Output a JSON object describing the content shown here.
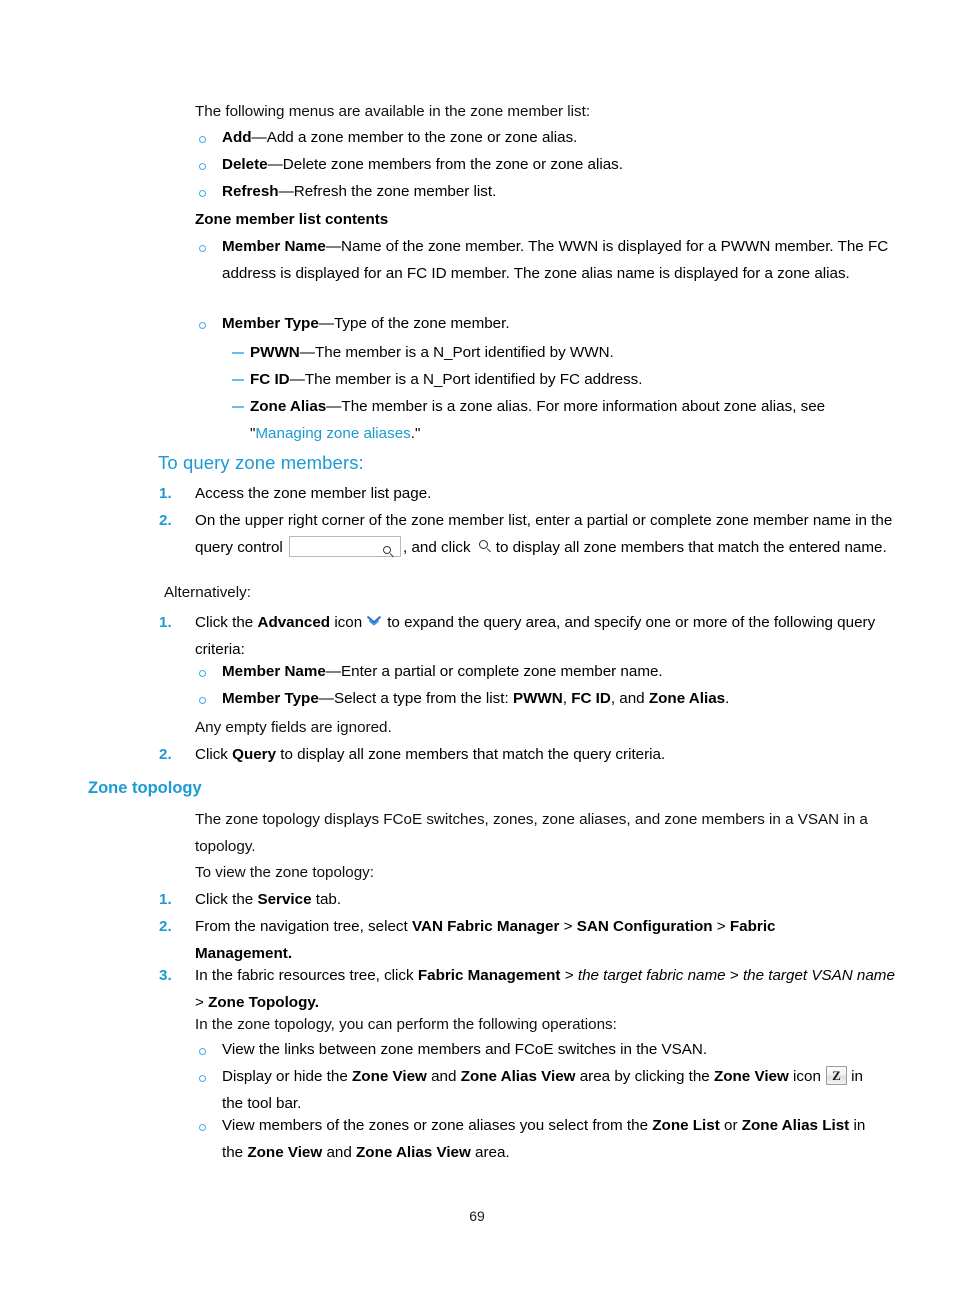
{
  "page": {
    "folio": "69"
  },
  "intro": {
    "text": "The following menus are available in the zone member list:"
  },
  "menu_bullets": [
    {
      "term": "Add",
      "dash": "—",
      "desc": "Add a zone member to the zone or zone alias."
    },
    {
      "term": "Delete",
      "dash": "—",
      "desc": "Delete zone members from the zone or zone alias."
    },
    {
      "term": "Refresh",
      "dash": "—",
      "desc": "Refresh the zone member list."
    }
  ],
  "contents_heading": "Zone member list contents",
  "contents_bullets": [
    {
      "term": "Member Name",
      "dash": "—",
      "desc": "Name of the zone member. The WWN is displayed for a PWWN member. The FC address is displayed for an FC ID member. The zone alias name is displayed for a zone alias."
    },
    {
      "term": "Member Type",
      "dash": "—",
      "desc": "Type of the zone member."
    }
  ],
  "member_types": [
    {
      "term": "PWWN",
      "dash": "—",
      "desc": "The member is a N_Port identified by WWN."
    },
    {
      "term": "FC ID",
      "dash": "—",
      "desc": "The member is a N_Port identified by FC address."
    },
    {
      "term": "Zone Alias",
      "dash": "—",
      "desc_before": "The member is a zone alias. For more information about zone alias, see",
      "quote_open": "\"",
      "link": "Managing zone aliases",
      "quote_close": ".\""
    }
  ],
  "query_section": {
    "heading": "To query zone members:",
    "step1_num": "1.",
    "step1_text": "Access the zone member list page.",
    "step2_num": "2.",
    "step2_part1": "On the upper right corner of the zone member list, enter a partial or complete zone member name in the query control",
    "step2_part2": ", and click",
    "step2_part3": "to display all zone members that match the entered name.",
    "query_control_value": "",
    "query_control_placeholder": "",
    "search_icon": "search-icon",
    "search_icon_2": "search-icon"
  },
  "alternatively": {
    "label": "Alternatively:",
    "step1_num": "1.",
    "step1_before": "Click the",
    "step1_bold": "Advanced",
    "step1_mid": "icon",
    "advanced_icon": "double-chevron-down-icon",
    "step1_after": "to expand the query area, and specify one or more of the following query criteria:",
    "criteria": [
      {
        "term": "Member Name",
        "dash": "—",
        "desc": "Enter a partial or complete zone member name."
      },
      {
        "term": "Member Type",
        "dash": "—",
        "desc_before": "Select a type from the list:",
        "opt1": "PWWN",
        "sep1": ",",
        "opt2": "FC ID",
        "sep2": ", and",
        "opt3": "Zone Alias",
        "desc_after": "."
      }
    ],
    "note": "Any empty fields are ignored.",
    "step2_num": "2.",
    "step2_before": "Click",
    "step2_bold": "Query",
    "step2_after": "to display all zone members that match the query criteria."
  },
  "zone_topology": {
    "heading": "Zone topology",
    "intro": "The zone topology displays FCoE switches, zones, zone aliases, and zone members in a VSAN in a topology.",
    "lead": "To view the zone topology:",
    "steps": [
      {
        "num": "1.",
        "before": "Click the",
        "bold": "Service",
        "after": "tab."
      },
      {
        "num": "2.",
        "before": "From the navigation tree, select",
        "bold1": "VAN Fabric Manager",
        "gt1": ">",
        "bold2": "SAN Configuration",
        "gt2": ">",
        "bold3": "Fabric Management",
        "after": "."
      },
      {
        "num": "3.",
        "before": "In the fabric resources tree, click",
        "bold1": "Fabric Management",
        "gt1": ">",
        "italic1": "the target fabric name",
        "gt2": ">",
        "italic2": "the target VSAN name",
        "gt3": ">",
        "bold2": "Zone Topology",
        "after": "."
      }
    ],
    "ops_lead": "In the zone topology, you can perform the following operations:",
    "operations": [
      {
        "text": "View the links between zone members and FCoE switches in the VSAN."
      },
      {
        "before": "Display or hide the",
        "bold1": "Zone View",
        "mid1": "and",
        "bold2": "Zone Alias View",
        "mid2": "area by clicking the",
        "bold3": "Zone View",
        "mid3": "icon",
        "icon_label": "Z",
        "icon_name": "zone-view-icon",
        "after": "in the tool bar."
      },
      {
        "before": "View members of the zones or zone aliases you select from the",
        "bold1": "Zone List",
        "mid1": "or",
        "bold2": "Zone Alias List",
        "mid2": "in the",
        "bold3": "Zone View",
        "mid3": "and",
        "bold4": "Zone Alias View",
        "after": "area."
      }
    ]
  },
  "colors": {
    "heading_blue": "#1b9ad6",
    "bullet_blue": "#3fb0e4",
    "dash_blue": "#63c0e8",
    "text_black": "#101010"
  }
}
